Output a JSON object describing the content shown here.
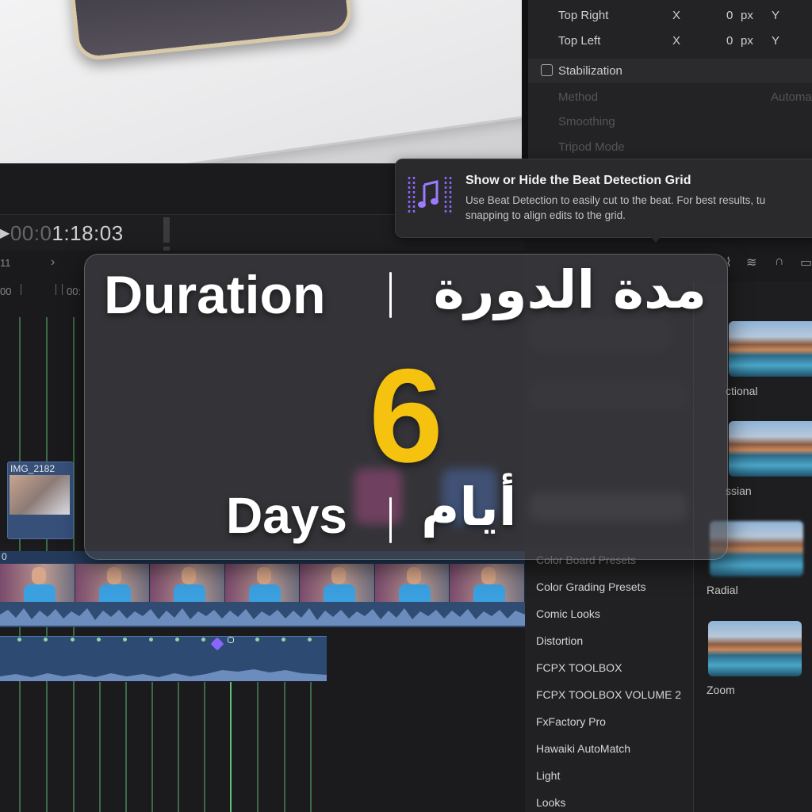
{
  "inspector": {
    "rows": [
      {
        "label": "Top Right",
        "axis_x": "X",
        "value": "0",
        "unit": "px",
        "axis_y": "Y"
      },
      {
        "label": "Top Left",
        "axis_x": "X",
        "value": "0",
        "unit": "px",
        "axis_y": "Y"
      }
    ],
    "stabilization_label": "Stabilization",
    "method_label": "Method",
    "method_value": "Automat",
    "smoothing_label": "Smoothing",
    "tripod_label": "Tripod Mode"
  },
  "tooltip": {
    "title": "Show or Hide the Beat Detection Grid",
    "line1": "Use Beat Detection to easily cut to the beat. For best results, tu",
    "line2": "snapping to align edits to the grid."
  },
  "timeline": {
    "timecode_dim": "00:0",
    "timecode": "1:18:03",
    "ruler_left": "11",
    "ruler_00": "00",
    "ruler_00b": "00:",
    "clip_name": "IMG_2182",
    "track_index": "0"
  },
  "overlay": {
    "label_en": "Duration",
    "label_ar": "مدة الدورة",
    "number": "6",
    "unit_en": "Days",
    "unit_ar": "أيام"
  },
  "browser": {
    "items": [
      "Color Board Presets",
      "Color Grading Presets",
      "Comic Looks",
      "Distortion",
      "FCPX TOOLBOX",
      "FCPX TOOLBOX VOLUME 2",
      "FxFactory Pro",
      "Hawaiki AutoMatch",
      "Light",
      "Looks"
    ],
    "thumbs": [
      "ctional",
      "ssian",
      "Radial",
      "Zoom"
    ]
  },
  "colors": {
    "accent_number": "#f5c210",
    "beat_purple": "#8a66ff",
    "track_blue": "#304c73"
  }
}
